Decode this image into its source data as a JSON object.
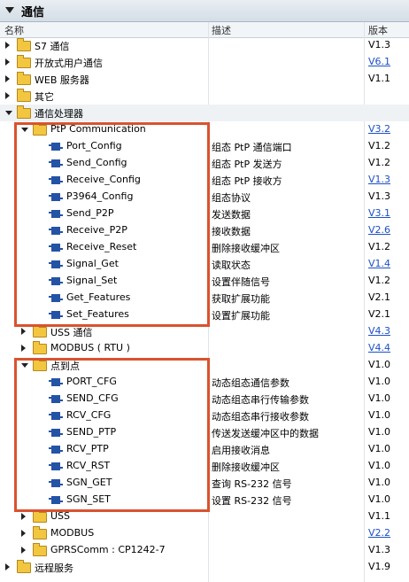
{
  "panel": {
    "title": "通信"
  },
  "columns": {
    "name": "名称",
    "desc": "描述",
    "version": "版本"
  },
  "rows": [
    {
      "level": 0,
      "kind": "folder",
      "expanded": false,
      "name": "S7 通信",
      "desc": "",
      "version": "V1.3",
      "link": false
    },
    {
      "level": 0,
      "kind": "folder",
      "expanded": false,
      "name": "开放式用户通信",
      "desc": "",
      "version": "V6.1",
      "link": true
    },
    {
      "level": 0,
      "kind": "folder",
      "expanded": false,
      "name": "WEB 服务器",
      "desc": "",
      "version": "V1.1",
      "link": false
    },
    {
      "level": 0,
      "kind": "folder",
      "expanded": false,
      "name": "其它",
      "desc": "",
      "version": "",
      "link": false
    },
    {
      "level": 0,
      "kind": "folder",
      "expanded": true,
      "name": "通信处理器",
      "desc": "",
      "version": "",
      "link": false,
      "selected": true
    },
    {
      "level": 1,
      "kind": "folder",
      "expanded": true,
      "name": "PtP Communication",
      "desc": "",
      "version": "V3.2",
      "link": true
    },
    {
      "level": 2,
      "kind": "block",
      "name": "Port_Config",
      "desc": "组态 PtP 通信端口",
      "version": "V1.2",
      "link": false
    },
    {
      "level": 2,
      "kind": "block",
      "name": "Send_Config",
      "desc": "组态 PtP 发送方",
      "version": "V1.2",
      "link": false
    },
    {
      "level": 2,
      "kind": "block",
      "name": "Receive_Config",
      "desc": "组态 PtP 接收方",
      "version": "V1.3",
      "link": true
    },
    {
      "level": 2,
      "kind": "block",
      "name": "P3964_Config",
      "desc": "组态协议",
      "version": "V1.3",
      "link": false
    },
    {
      "level": 2,
      "kind": "block",
      "name": "Send_P2P",
      "desc": "发送数据",
      "version": "V3.1",
      "link": true
    },
    {
      "level": 2,
      "kind": "block",
      "name": "Receive_P2P",
      "desc": "接收数据",
      "version": "V2.6",
      "link": true
    },
    {
      "level": 2,
      "kind": "block",
      "name": "Receive_Reset",
      "desc": "删除接收缓冲区",
      "version": "V1.2",
      "link": false
    },
    {
      "level": 2,
      "kind": "block",
      "name": "Signal_Get",
      "desc": "读取状态",
      "version": "V1.4",
      "link": true
    },
    {
      "level": 2,
      "kind": "block",
      "name": "Signal_Set",
      "desc": "设置伴随信号",
      "version": "V1.2",
      "link": false
    },
    {
      "level": 2,
      "kind": "block",
      "name": "Get_Features",
      "desc": "获取扩展功能",
      "version": "V2.1",
      "link": false
    },
    {
      "level": 2,
      "kind": "block",
      "name": "Set_Features",
      "desc": "设置扩展功能",
      "version": "V2.1",
      "link": false
    },
    {
      "level": 1,
      "kind": "folder",
      "expanded": false,
      "name": "USS 通信",
      "desc": "",
      "version": "V4.3",
      "link": true
    },
    {
      "level": 1,
      "kind": "folder",
      "expanded": false,
      "name": "MODBUS ( RTU )",
      "desc": "",
      "version": "V4.4",
      "link": true
    },
    {
      "level": 1,
      "kind": "folder",
      "expanded": true,
      "name": "点到点",
      "desc": "",
      "version": "V1.0",
      "link": false
    },
    {
      "level": 2,
      "kind": "block",
      "name": "PORT_CFG",
      "desc": "动态组态通信参数",
      "version": "V1.0",
      "link": false
    },
    {
      "level": 2,
      "kind": "block",
      "name": "SEND_CFG",
      "desc": "动态组态串行传输参数",
      "version": "V1.0",
      "link": false
    },
    {
      "level": 2,
      "kind": "block",
      "name": "RCV_CFG",
      "desc": "动态组态串行接收参数",
      "version": "V1.0",
      "link": false
    },
    {
      "level": 2,
      "kind": "block",
      "name": "SEND_PTP",
      "desc": "传送发送缓冲区中的数据",
      "version": "V1.0",
      "link": false
    },
    {
      "level": 2,
      "kind": "block",
      "name": "RCV_PTP",
      "desc": "启用接收消息",
      "version": "V1.0",
      "link": false
    },
    {
      "level": 2,
      "kind": "block",
      "name": "RCV_RST",
      "desc": "删除接收缓冲区",
      "version": "V1.0",
      "link": false
    },
    {
      "level": 2,
      "kind": "block",
      "name": "SGN_GET",
      "desc": "查询 RS-232 信号",
      "version": "V1.0",
      "link": false
    },
    {
      "level": 2,
      "kind": "block",
      "name": "SGN_SET",
      "desc": "设置 RS-232 信号",
      "version": "V1.0",
      "link": false
    },
    {
      "level": 1,
      "kind": "folder",
      "expanded": false,
      "name": "USS",
      "desc": "",
      "version": "V1.1",
      "link": false
    },
    {
      "level": 1,
      "kind": "folder",
      "expanded": false,
      "name": "MODBUS",
      "desc": "",
      "version": "V2.2",
      "link": true
    },
    {
      "level": 1,
      "kind": "folder",
      "expanded": false,
      "name": "GPRSComm : CP1242-7",
      "desc": "",
      "version": "V1.3",
      "link": false
    },
    {
      "level": 0,
      "kind": "folder",
      "expanded": false,
      "name": "远程服务",
      "desc": "",
      "version": "V1.9",
      "link": false
    }
  ],
  "icons": {
    "folder": "folder-icon",
    "block": "function-block-icon",
    "expanded": "triangle-down-icon",
    "collapsed": "triangle-right-icon"
  },
  "colors": {
    "highlight": "#d9532f",
    "link": "#1c4fc9",
    "folder": "#f2c63f",
    "block": "#2453a6"
  }
}
